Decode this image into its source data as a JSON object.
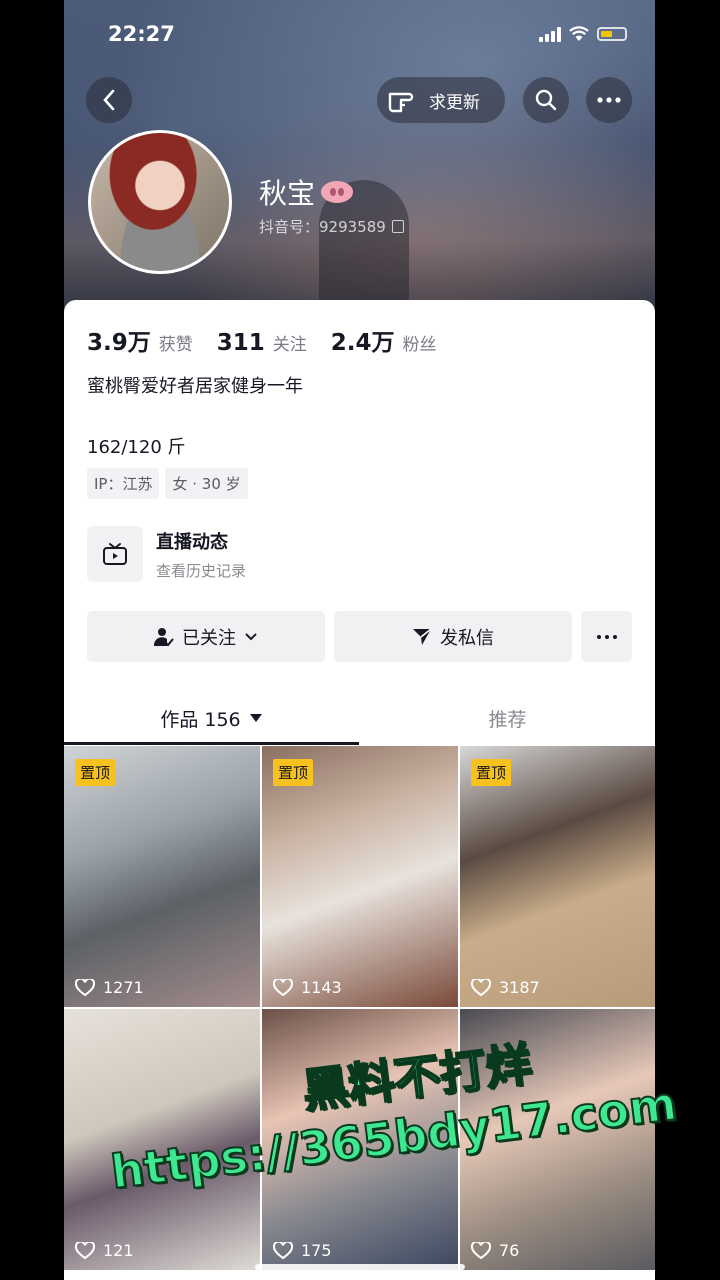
{
  "status": {
    "time": "22:27"
  },
  "header": {
    "request_update_label": "求更新"
  },
  "profile": {
    "name": "秋宝",
    "douyin_id": "抖音号：9293589",
    "stats": [
      {
        "value": "3.9万",
        "label": "获赞"
      },
      {
        "value": "311",
        "label": "关注"
      },
      {
        "value": "2.4万",
        "label": "粉丝"
      }
    ],
    "bio": "蜜桃臀爱好者居家健身一年",
    "weight": "162/120 斤",
    "tags": [
      "IP：江苏",
      "女 · 30 岁"
    ]
  },
  "live": {
    "title": "直播动态",
    "subtitle": "查看历史记录"
  },
  "actions": {
    "followed_label": "已关注",
    "message_label": "发私信"
  },
  "tabs": {
    "works_label": "作品 156",
    "recommend_label": "推荐"
  },
  "videos": [
    {
      "pinned": "置顶",
      "likes": "1271"
    },
    {
      "pinned": "置顶",
      "likes": "1143"
    },
    {
      "pinned": "置顶",
      "likes": "3187"
    },
    {
      "pinned": "",
      "likes": "121"
    },
    {
      "pinned": "",
      "likes": "175"
    },
    {
      "pinned": "",
      "likes": "76"
    }
  ],
  "watermark": {
    "line1": "黑料不打烊",
    "line2": "https://365bdy17.com"
  },
  "colors": {
    "pin_badge": "#f7c21e",
    "watermark": "#3ee890"
  }
}
